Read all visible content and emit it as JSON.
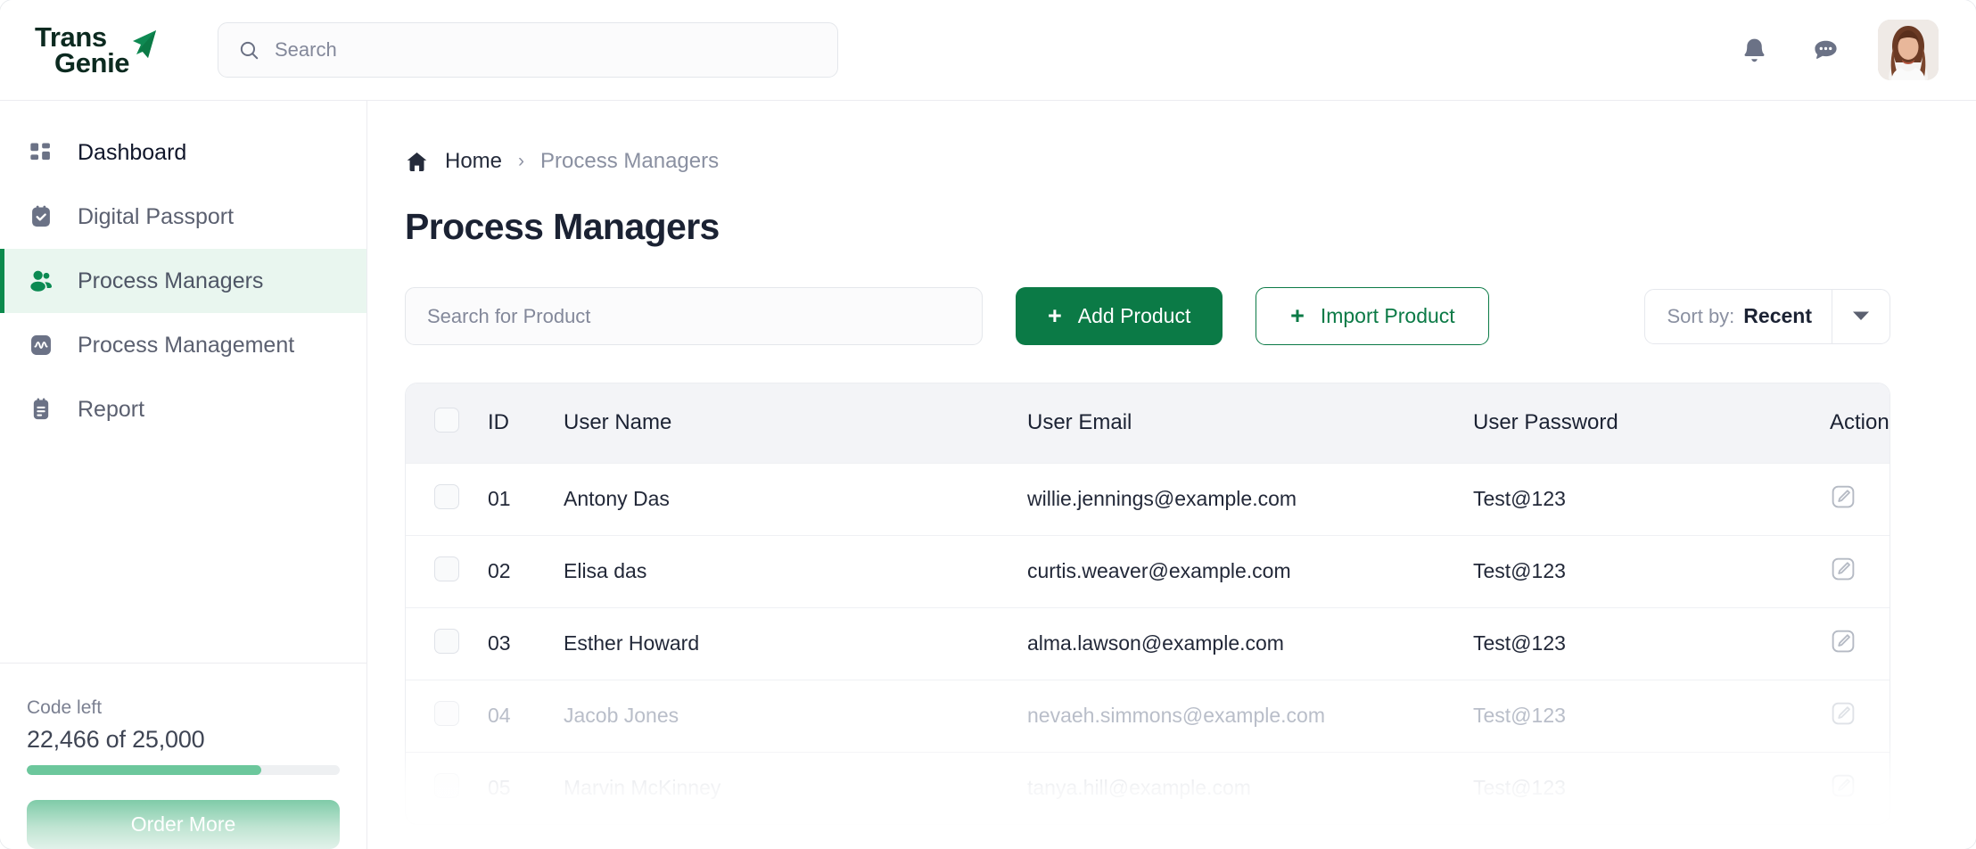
{
  "brand": {
    "name_line1": "Trans",
    "name_line2": "Genie",
    "accent_green": "#0b7a46",
    "logo_dark": "#0c2a20"
  },
  "topbar": {
    "search": {
      "placeholder": "Search",
      "value": "",
      "icon": "search-icon"
    },
    "notifications_icon": "bell-icon",
    "messages_icon": "chat-bubble-icon",
    "avatar_alt": "user-avatar"
  },
  "sidebar": {
    "items": [
      {
        "label": "Dashboard",
        "icon": "grid-icon",
        "active": false
      },
      {
        "label": "Digital Passport",
        "icon": "passport-check-icon",
        "active": false
      },
      {
        "label": "Process Managers",
        "icon": "users-icon",
        "active": true
      },
      {
        "label": "Process Management",
        "icon": "activity-icon",
        "active": false
      },
      {
        "label": "Report",
        "icon": "report-icon",
        "active": false
      }
    ],
    "quota": {
      "label": "Code left",
      "value": "22,466 of 25,000",
      "used": 22466,
      "total": 25000,
      "percent": 75,
      "fill_color": "#6cc79c"
    },
    "order_button": "Order More"
  },
  "breadcrumb": {
    "home_icon": "home-icon",
    "home": "Home",
    "separator": "›",
    "current": "Process Managers"
  },
  "page": {
    "title": "Process Managers"
  },
  "toolbar": {
    "search": {
      "placeholder": "Search for Product",
      "value": ""
    },
    "add_button": {
      "label": "Add Product",
      "icon": "plus-icon"
    },
    "import_button": {
      "label": "Import Product",
      "icon": "plus-icon"
    },
    "sort": {
      "label": "Sort by:",
      "value": "Recent",
      "icon": "chevron-down-icon"
    }
  },
  "table": {
    "columns": [
      "",
      "ID",
      "User Name",
      "User Email",
      "User Password",
      "Action"
    ],
    "rows": [
      {
        "id": "01",
        "name": "Antony Das",
        "email": "willie.jennings@example.com",
        "password": "Test@123",
        "action_icon": "edit-icon",
        "dim": false
      },
      {
        "id": "02",
        "name": "Elisa das",
        "email": "curtis.weaver@example.com",
        "password": "Test@123",
        "action_icon": "edit-icon",
        "dim": false
      },
      {
        "id": "03",
        "name": "Esther Howard",
        "email": "alma.lawson@example.com",
        "password": "Test@123",
        "action_icon": "edit-icon",
        "dim": false
      },
      {
        "id": "04",
        "name": "Jacob Jones",
        "email": "nevaeh.simmons@example.com",
        "password": "Test@123",
        "action_icon": "edit-icon",
        "dim": true
      },
      {
        "id": "05",
        "name": "Marvin McKinney",
        "email": "tanya.hill@example.com",
        "password": "Test@123",
        "action_icon": "edit-icon",
        "dim": true
      }
    ]
  }
}
